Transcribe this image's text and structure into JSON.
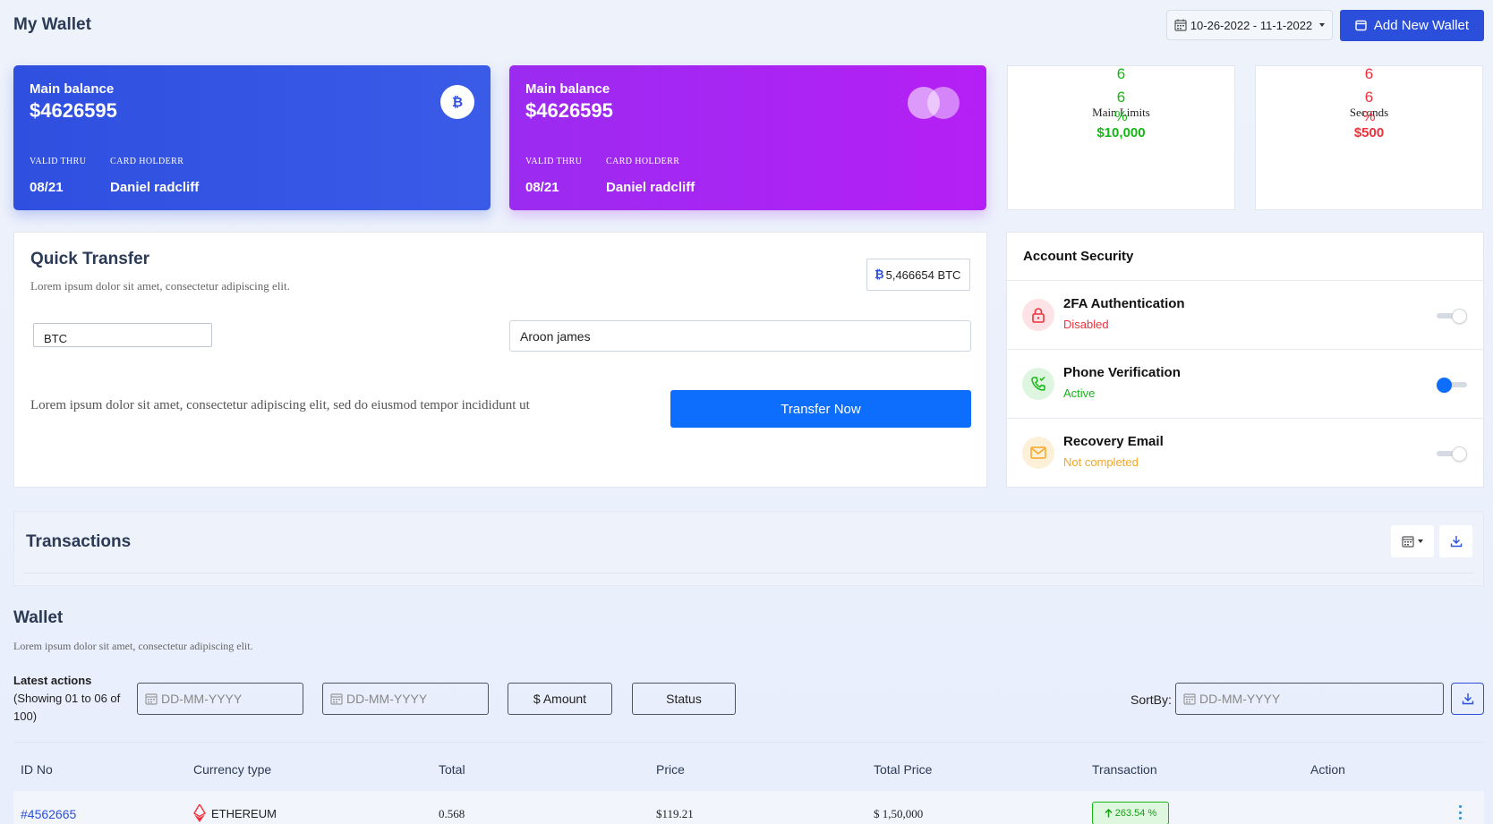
{
  "header": {
    "title": "My Wallet",
    "date_range": "10-26-2022 - 11-1-2022",
    "add_wallet_label": "Add New Wallet"
  },
  "cards": [
    {
      "label": "Main balance",
      "amount": "$4626595",
      "valid_thru_label": "VALID THRU",
      "valid_thru": "08/21",
      "holder_label": "CARD HOLDERR",
      "holder": "Daniel radcliff",
      "icon": "bitcoin-icon"
    },
    {
      "label": "Main balance",
      "amount": "$4626595",
      "valid_thru_label": "VALID THRU",
      "valid_thru": "08/21",
      "holder_label": "CARD HOLDERR",
      "holder": "Daniel radcliff",
      "icon": "mastercard-icon"
    }
  ],
  "limits": [
    {
      "pct_a": "6",
      "pct_b": "6",
      "pct_sign": "%",
      "name": "Main Limits",
      "value": "$10,000",
      "color": "#16b616"
    },
    {
      "pct_a": "6",
      "pct_b": "6",
      "pct_sign": "%",
      "name": "Seconds",
      "value": "$500",
      "color": "#f0303a"
    }
  ],
  "quick_transfer": {
    "title": "Quick Transfer",
    "subtitle": "Lorem ipsum dolor sit amet, consectetur adipiscing elit.",
    "btc_amount": "5,466654 BTC",
    "currency_select": "BTC",
    "recipient": "Aroon james",
    "description": "Lorem ipsum dolor sit amet, consectetur adipiscing elit, sed do eiusmod tempor incididunt ut",
    "button": "Transfer Now"
  },
  "security": {
    "title": "Account Security",
    "items": [
      {
        "name": "2FA Authentication",
        "status": "Disabled",
        "status_color": "#f0303a",
        "icon": "lock-icon",
        "enabled": false
      },
      {
        "name": "Phone Verification",
        "status": "Active",
        "status_color": "#16b616",
        "icon": "phone-icon",
        "enabled": true
      },
      {
        "name": "Recovery Email",
        "status": "Not completed",
        "status_color": "#f5a623",
        "icon": "mail-icon",
        "enabled": false
      }
    ]
  },
  "transactions": {
    "title": "Transactions"
  },
  "wallet": {
    "title": "Wallet",
    "subtitle": "Lorem ipsum dolor sit amet, consectetur adipiscing elit.",
    "latest_title": "Latest actions",
    "latest_info": "(Showing 01 to 06 of 100)",
    "date_placeholder": "DD-MM-YYYY",
    "amount_label": "$ Amount",
    "status_label": "Status",
    "sortby_label": "SortBy:"
  },
  "table": {
    "columns": [
      "ID No",
      "Currency type",
      "Total",
      "Price",
      "Total Price",
      "Transaction",
      "Action"
    ],
    "rows": [
      {
        "id": "#4562665",
        "currency": "ETHEREUM",
        "total": "0.568",
        "price": "$119.21",
        "total_price": "$ 1,50,000",
        "transaction": "263.54 %"
      }
    ]
  },
  "colors": {
    "accent": "#2b4fdb",
    "purple": "#b51ff5",
    "green": "#16b616",
    "red": "#f0303a",
    "orange": "#f5a623"
  }
}
